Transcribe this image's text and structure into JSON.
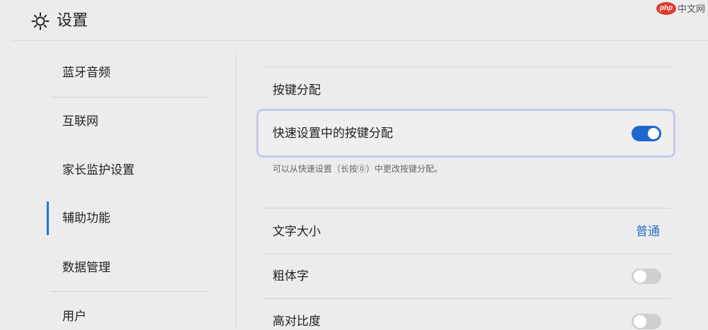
{
  "header": {
    "title": "设置",
    "icon": "gear-icon"
  },
  "watermark": {
    "logo": "php",
    "text": "中文网"
  },
  "sidebar": {
    "items": [
      {
        "label": "蓝牙音频"
      },
      {
        "label": "互联网"
      },
      {
        "label": "家长监护设置"
      },
      {
        "label": "辅助功能",
        "selected": true
      },
      {
        "label": "数据管理"
      },
      {
        "label": "用户"
      }
    ],
    "accent_color": "#1a73e8"
  },
  "main": {
    "section_title": "按键分配",
    "quick_assign": {
      "label": "快速设置中的按键分配",
      "enabled": true,
      "hint": "可以从快速设置（长按⓪）中更改按键分配。"
    },
    "text_size": {
      "label": "文字大小",
      "value": "普通"
    },
    "bold_text": {
      "label": "粗体字",
      "enabled": false
    },
    "high_contrast": {
      "label": "高对比度",
      "enabled": false
    },
    "accent_color": "#1f66cf",
    "link_color": "#2a6fc4"
  }
}
